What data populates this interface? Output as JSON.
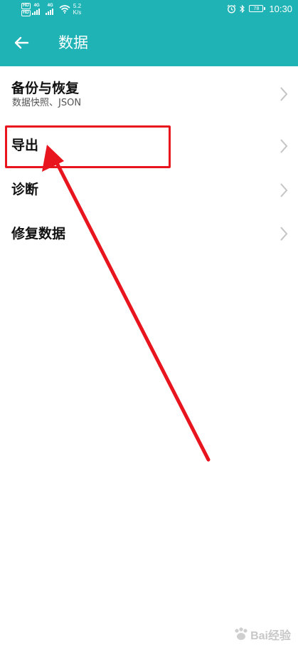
{
  "status_bar": {
    "hd_labels": [
      "HD",
      "HD"
    ],
    "sim1_network": "4G",
    "sim2_network": "4G",
    "speed_value": "5.2",
    "speed_unit": "K/s",
    "battery_level": "78",
    "time": "10:30"
  },
  "header": {
    "title": "数据",
    "background_color": "#1fb3b6"
  },
  "list": {
    "items": [
      {
        "label": "备份与恢复",
        "sublabel": "数据快照、JSON"
      },
      {
        "label": "导出"
      },
      {
        "label": "诊断"
      },
      {
        "label": "修复数据"
      }
    ]
  },
  "annotation": {
    "highlighted_item": "导出",
    "color": "#e8141e"
  },
  "watermark": {
    "text": "Bai经验"
  }
}
